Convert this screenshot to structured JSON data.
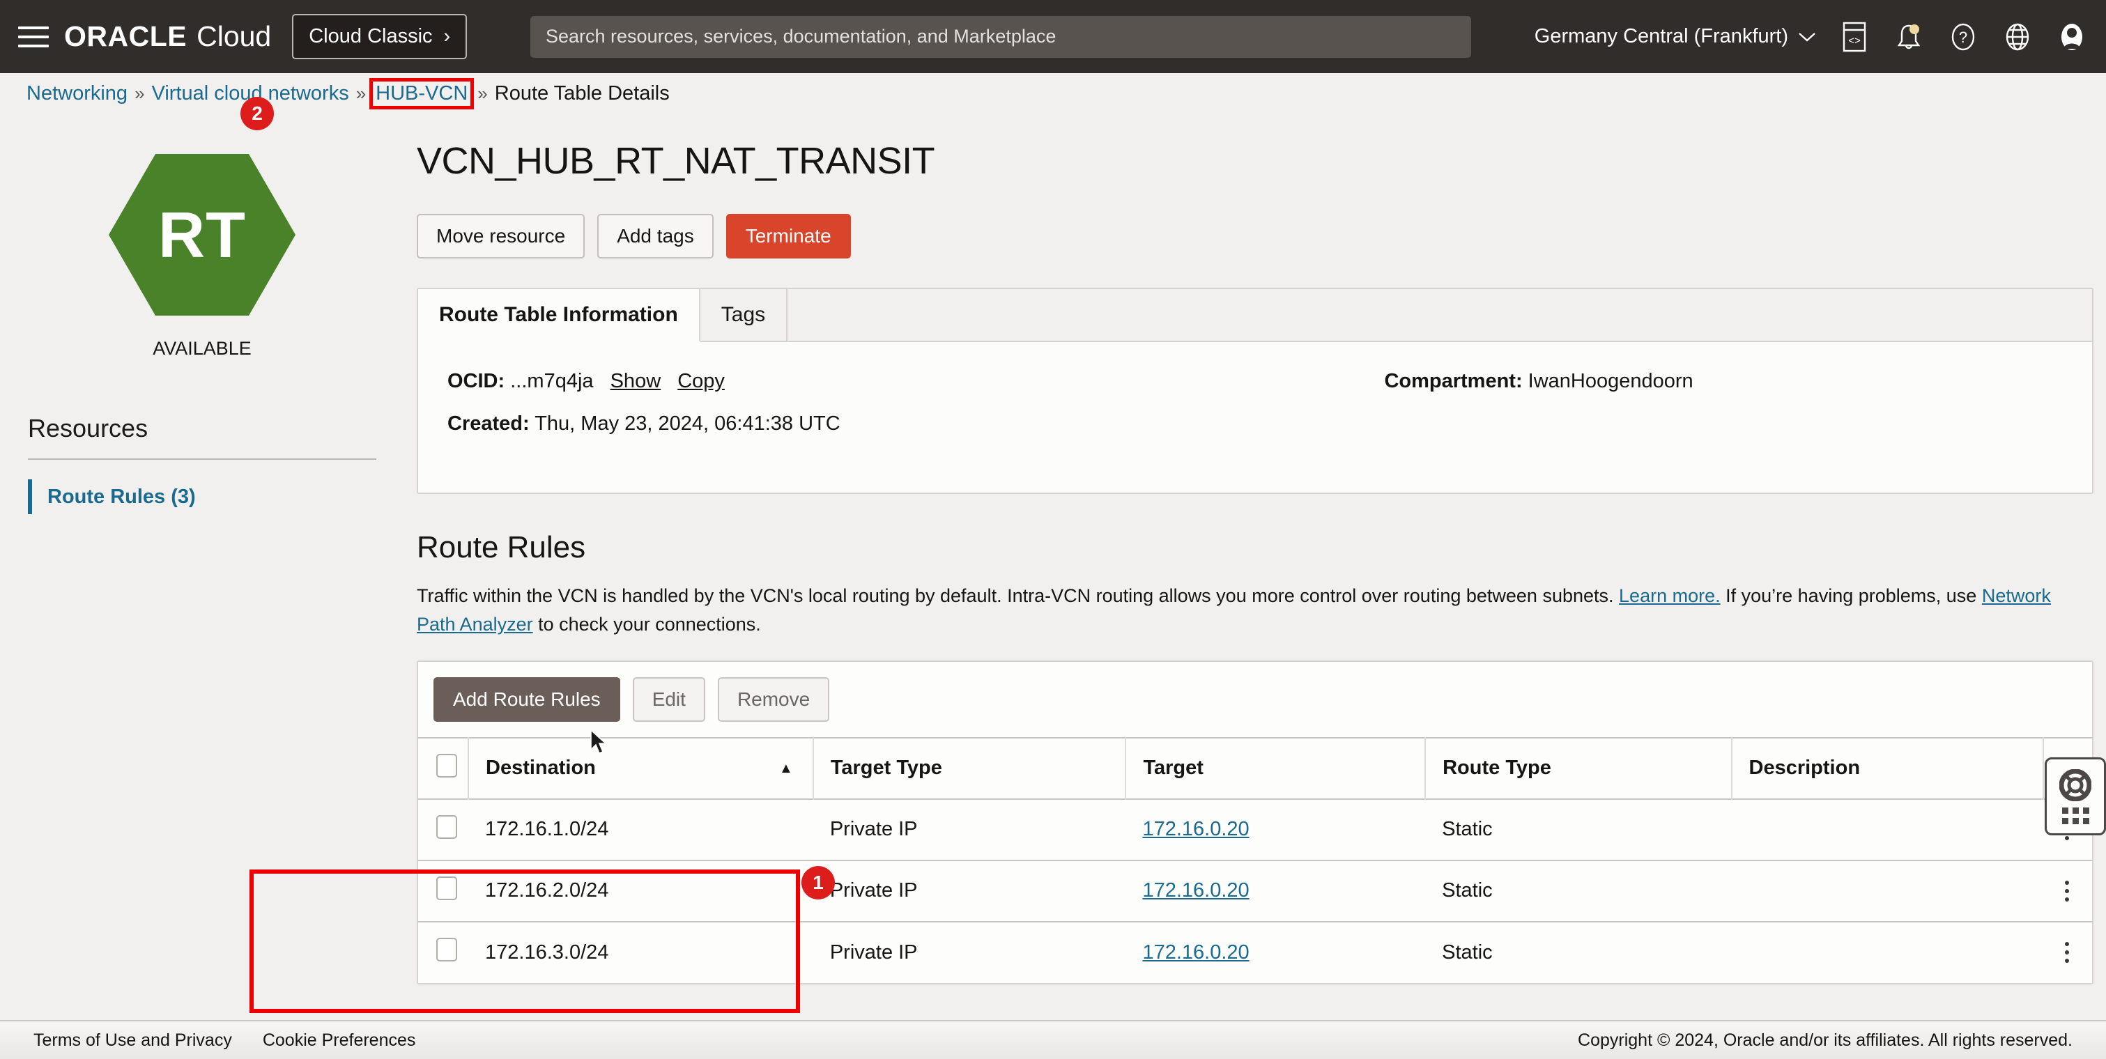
{
  "topbar": {
    "menu_icon": "hamburger-icon",
    "brand_primary": "ORACLE",
    "brand_secondary": "Cloud",
    "cloud_classic_label": "Cloud Classic",
    "cloud_classic_chevron": "›",
    "search_placeholder": "Search resources, services, documentation, and Marketplace",
    "search_value": "",
    "region": "Germany Central (Frankfurt)",
    "region_chevron": "⌄",
    "icons": [
      "cloud-shell-icon",
      "notifications-bell-icon",
      "help-question-icon",
      "language-globe-icon",
      "user-avatar-icon"
    ]
  },
  "breadcrumb": {
    "items": [
      {
        "label": "Networking",
        "type": "link"
      },
      {
        "label": "Virtual cloud networks",
        "type": "link"
      },
      {
        "label": "HUB-VCN",
        "type": "link",
        "highlighted": true
      },
      {
        "label": "Route Table Details",
        "type": "current"
      }
    ],
    "separator": "»"
  },
  "annotations": [
    {
      "id": "1",
      "label": "1",
      "target": "route-rules-table-rows"
    },
    {
      "id": "2",
      "label": "2",
      "target": "breadcrumb-hub-vcn"
    }
  ],
  "left_rail": {
    "resource_badge": "RT",
    "status": "AVAILABLE",
    "resources_heading": "Resources",
    "items": [
      {
        "label": "Route Rules (3)",
        "active": true
      }
    ]
  },
  "main": {
    "page_title": "VCN_HUB_RT_NAT_TRANSIT",
    "actions": [
      {
        "label": "Move resource",
        "style": "plain"
      },
      {
        "label": "Add tags",
        "style": "plain"
      },
      {
        "label": "Terminate",
        "style": "danger"
      }
    ],
    "tabs": [
      {
        "label": "Route Table Information",
        "active": true
      },
      {
        "label": "Tags",
        "active": false
      }
    ],
    "details": {
      "ocid_label": "OCID:",
      "ocid_value": "...m7q4ja",
      "ocid_show": "Show",
      "ocid_copy": "Copy",
      "created_label": "Created:",
      "created_value": "Thu, May 23, 2024, 06:41:38 UTC",
      "compartment_label": "Compartment:",
      "compartment_value": "IwanHoogendoorn"
    },
    "section": {
      "title": "Route Rules",
      "desc_part1": "Traffic within the VCN is handled by the VCN's local routing by default. Intra-VCN routing allows you more control over routing between subnets.",
      "desc_link1": "Learn more.",
      "desc_part2": "If you’re having problems, use",
      "desc_link2": "Network Path Analyzer",
      "desc_part3": "to check your connections."
    },
    "table": {
      "toolbar": [
        {
          "label": "Add Route Rules",
          "style": "primary",
          "enabled": true
        },
        {
          "label": "Edit",
          "style": "disabled",
          "enabled": false
        },
        {
          "label": "Remove",
          "style": "disabled",
          "enabled": false
        }
      ],
      "columns": [
        {
          "label": "Destination",
          "sort": "asc"
        },
        {
          "label": "Target Type",
          "sort": null
        },
        {
          "label": "Target",
          "sort": null
        },
        {
          "label": "Route Type",
          "sort": null
        },
        {
          "label": "Description",
          "sort": null
        }
      ],
      "sort_glyph": "▲",
      "rows": [
        {
          "destination": "172.16.1.0/24",
          "target_type": "Private IP",
          "target": "172.16.0.20",
          "route_type": "Static",
          "description": ""
        },
        {
          "destination": "172.16.2.0/24",
          "target_type": "Private IP",
          "target": "172.16.0.20",
          "route_type": "Static",
          "description": ""
        },
        {
          "destination": "172.16.3.0/24",
          "target_type": "Private IP",
          "target": "172.16.0.20",
          "route_type": "Static",
          "description": ""
        }
      ]
    },
    "help_widget": {
      "icon": "lifesaver-help-icon",
      "drag_handle": "dot-grid-handle"
    }
  },
  "footer": {
    "links": [
      "Terms of Use and Privacy",
      "Cookie Preferences"
    ],
    "copyright": "Copyright © 2024, Oracle and/or its affiliates. All rights reserved."
  },
  "colors": {
    "topbar_bg": "#312d2a",
    "accent_link": "#1a6a8f",
    "status_green": "#4a822a",
    "danger": "#d8452a",
    "annotation_red": "#ee0000",
    "primary_button": "#6b5e59"
  }
}
